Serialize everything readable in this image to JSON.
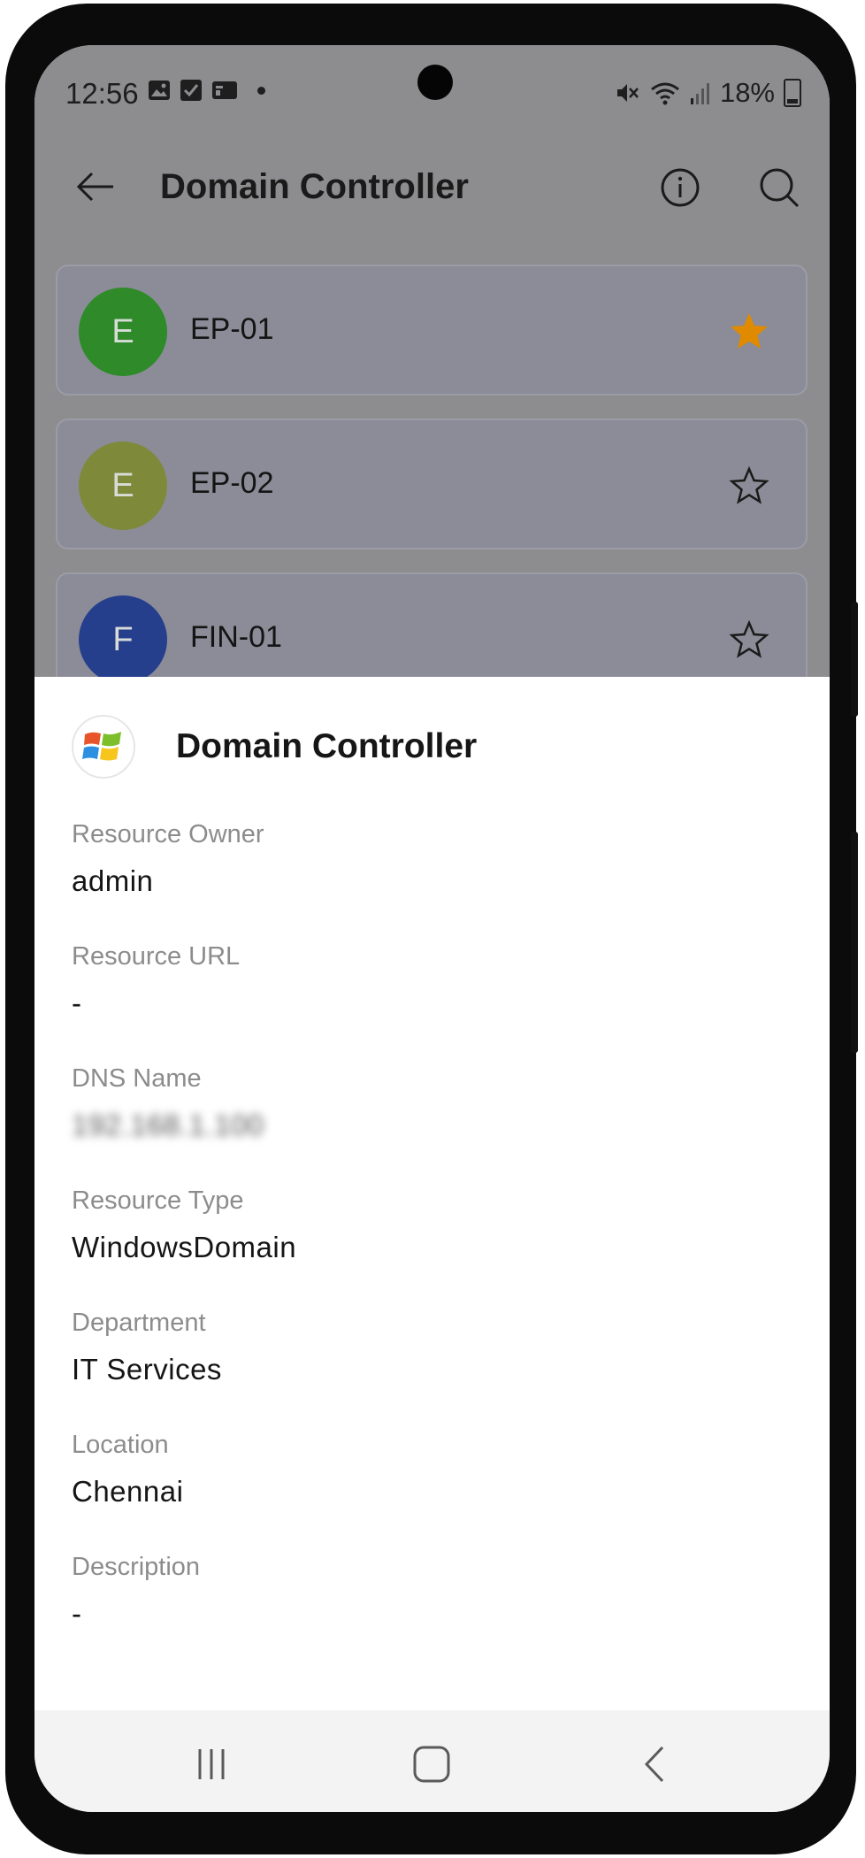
{
  "status_bar": {
    "time": "12:56",
    "battery": "18%",
    "icons": [
      "image-icon",
      "checkbox-icon",
      "card-icon",
      "dot-icon",
      "mute-icon",
      "wifi-icon",
      "signal-icon",
      "battery-icon"
    ]
  },
  "app_bar": {
    "title": "Domain Controller",
    "back_icon": "arrow-left-icon",
    "info_icon": "info-icon",
    "search_icon": "search-icon"
  },
  "resources": [
    {
      "initial": "E",
      "name": "EP-01",
      "avatar_color": "#2f8a2a",
      "favorite": true
    },
    {
      "initial": "E",
      "name": "EP-02",
      "avatar_color": "#7e8a3a",
      "favorite": false
    },
    {
      "initial": "F",
      "name": "FIN-01",
      "avatar_color": "#263f8c",
      "favorite": false
    }
  ],
  "sheet": {
    "title": "Domain Controller",
    "logo_icon": "windows-logo-icon",
    "fields": [
      {
        "label": "Resource Owner",
        "value": "admin"
      },
      {
        "label": "Resource URL",
        "value": "-"
      },
      {
        "label": "DNS Name",
        "value": "192.168.1.100"
      },
      {
        "label": "Resource Type",
        "value": "WindowsDomain"
      },
      {
        "label": "Department",
        "value": "IT Services"
      },
      {
        "label": "Location",
        "value": "Chennai"
      },
      {
        "label": "Description",
        "value": "-"
      }
    ]
  },
  "nav_bar": {
    "buttons": [
      "recents-icon",
      "home-icon",
      "back-icon"
    ]
  },
  "colors": {
    "favorite_star": "#e08a00",
    "scrim": "#8d8d8f",
    "sheet_bg": "#ffffff"
  }
}
